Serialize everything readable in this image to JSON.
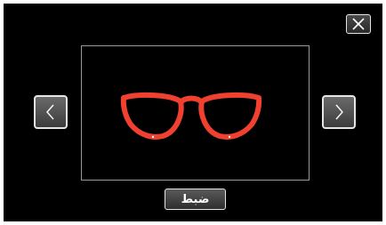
{
  "dialog": {
    "set_label": "ضبط",
    "close_icon": "close-x-icon",
    "prev_icon": "chevron-left-icon",
    "next_icon": "chevron-right-icon",
    "preview_icon": "glasses-icon"
  },
  "colors": {
    "background": "#000000",
    "frame_border": "#9a9a9a",
    "button_border": "#e6e6e6",
    "glasses": "#f0402f"
  }
}
